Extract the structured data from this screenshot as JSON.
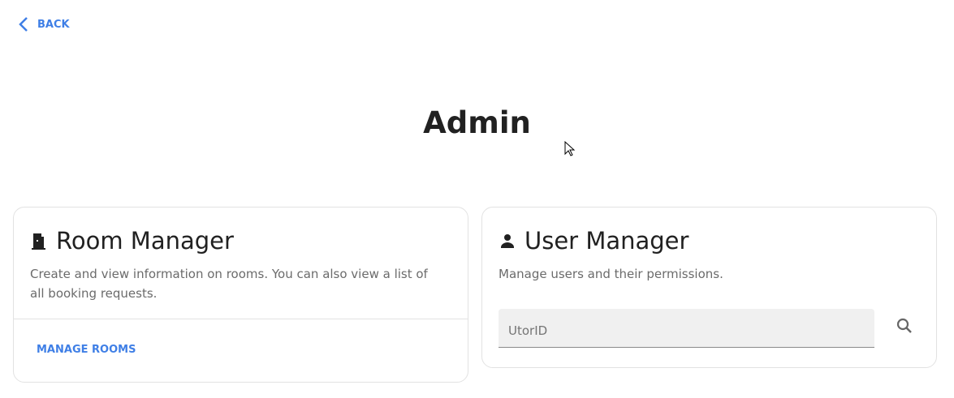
{
  "nav": {
    "back_label": "BACK"
  },
  "page": {
    "title": "Admin"
  },
  "room_manager": {
    "title": "Room Manager",
    "description": "Create and view information on rooms. You can also view a list of all booking requests.",
    "action_label": "MANAGE ROOMS",
    "icon": "door-icon"
  },
  "user_manager": {
    "title": "User Manager",
    "description": "Manage users and their permissions.",
    "search_placeholder": "UtorID",
    "icon": "person-icon",
    "search_icon": "search-icon"
  },
  "colors": {
    "accent": "#3f7fe6"
  }
}
